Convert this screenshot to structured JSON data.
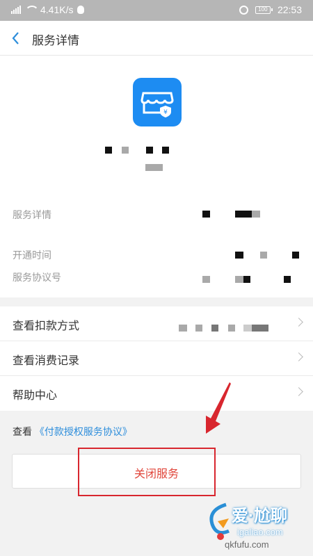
{
  "status_bar": {
    "network_label": "4G",
    "speed": "4.41K/s",
    "battery": "100",
    "time": "22:53"
  },
  "header": {
    "title": "服务详情",
    "back_icon": "chevron-left-icon"
  },
  "service": {
    "icon": "store-yuan-shield-icon",
    "icon_color": "#1d8cf2"
  },
  "info_rows": [
    {
      "label": "服务详情"
    },
    {
      "label": "开通时间"
    },
    {
      "label": "服务协议号"
    }
  ],
  "menu": [
    {
      "label": "查看扣款方式"
    },
    {
      "label": "查看消费记录"
    },
    {
      "label": "帮助中心"
    }
  ],
  "agreement": {
    "prefix": "查看",
    "link": "《付款授权服务协议》"
  },
  "close_button": {
    "label": "关闭服务"
  },
  "watermark": {
    "brand": "爱·尬聊",
    "url": "igaliao.com",
    "url2": "qkfufu.com"
  },
  "colors": {
    "accent": "#2c8ddb",
    "danger": "#e0453a",
    "annotation": "#d8262e"
  }
}
